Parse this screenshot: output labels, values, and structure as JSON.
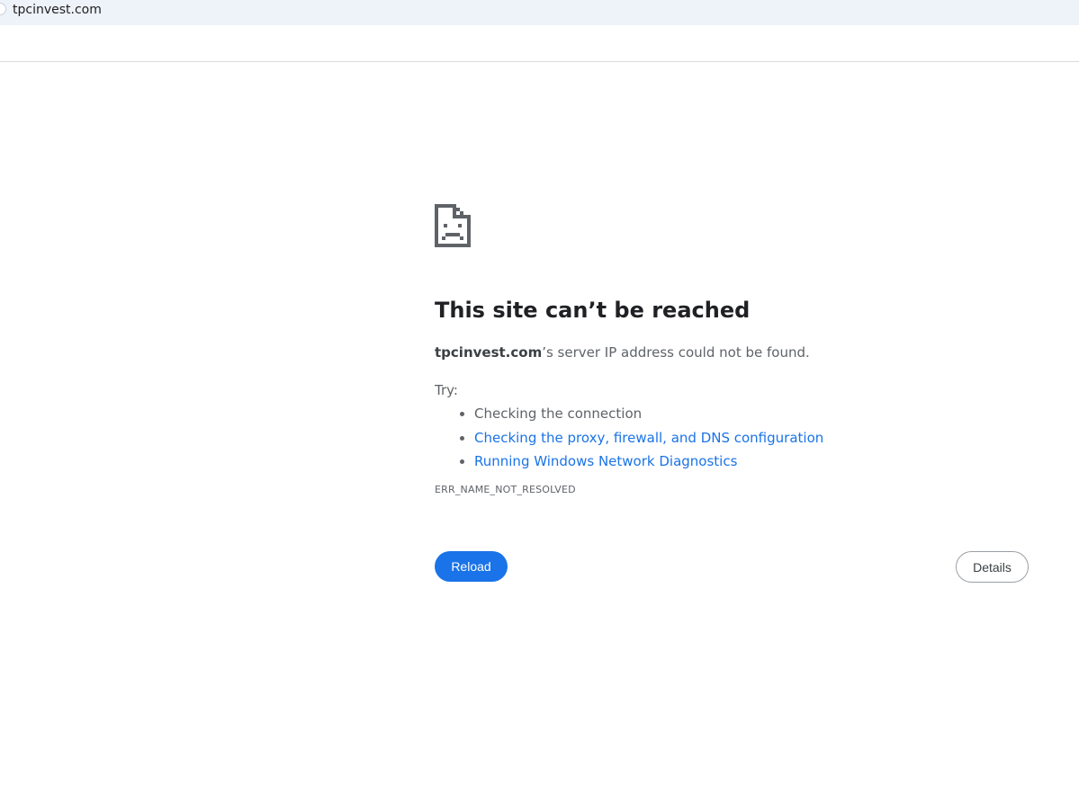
{
  "browser": {
    "url": "tpcinvest.com"
  },
  "error_page": {
    "title": "This site can’t be reached",
    "domain": "tpcinvest.com",
    "summary_suffix": "’s server IP address could not be found.",
    "try_label": "Try:",
    "suggestions": [
      {
        "label": "Checking the connection",
        "is_link": false
      },
      {
        "label": "Checking the proxy, firewall, and DNS configuration",
        "is_link": true
      },
      {
        "label": "Running Windows Network Diagnostics",
        "is_link": true
      }
    ],
    "error_code": "ERR_NAME_NOT_RESOLVED",
    "reload_label": "Reload",
    "details_label": "Details",
    "icon": "sad-page-icon"
  },
  "colors": {
    "accent": "#1a73e8",
    "text_primary": "#202124",
    "text_secondary": "#5f6368",
    "address_bar_bg": "#eef2f9"
  }
}
